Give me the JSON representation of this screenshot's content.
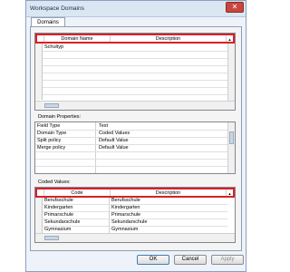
{
  "window": {
    "title": "Workspace Domains",
    "title_extra": "[ ... ]",
    "close_glyph": "✕"
  },
  "tabs": [
    {
      "label": "Domains"
    }
  ],
  "domains_grid": {
    "headers": [
      "Domain Name",
      "Description"
    ],
    "rows": [
      [
        "Schultyp",
        ""
      ]
    ],
    "sort_glyph": "▲"
  },
  "domain_properties": {
    "label": "Domain Properties:",
    "rows": [
      [
        "Field Type",
        "Text"
      ],
      [
        "Domain Type",
        "Coded Values"
      ],
      [
        "Split policy",
        "Default Value"
      ],
      [
        "Merge policy",
        "Default Value"
      ]
    ]
  },
  "coded_values": {
    "label": "Coded Values:",
    "headers": [
      "Code",
      "Description"
    ],
    "rows": [
      [
        "Berufsschule",
        "Berufsschule"
      ],
      [
        "Kindergarten",
        "Kindergarten"
      ],
      [
        "Primarschule",
        "Primarschule"
      ],
      [
        "Sekundarschule",
        "Sekundarschule"
      ],
      [
        "Gymnasium",
        "Gymnasium"
      ]
    ]
  },
  "buttons": {
    "ok": "OK",
    "cancel": "Cancel",
    "apply": "Apply"
  },
  "colors": {
    "highlight": "#d92027",
    "window_bg": "#eef3fa"
  }
}
